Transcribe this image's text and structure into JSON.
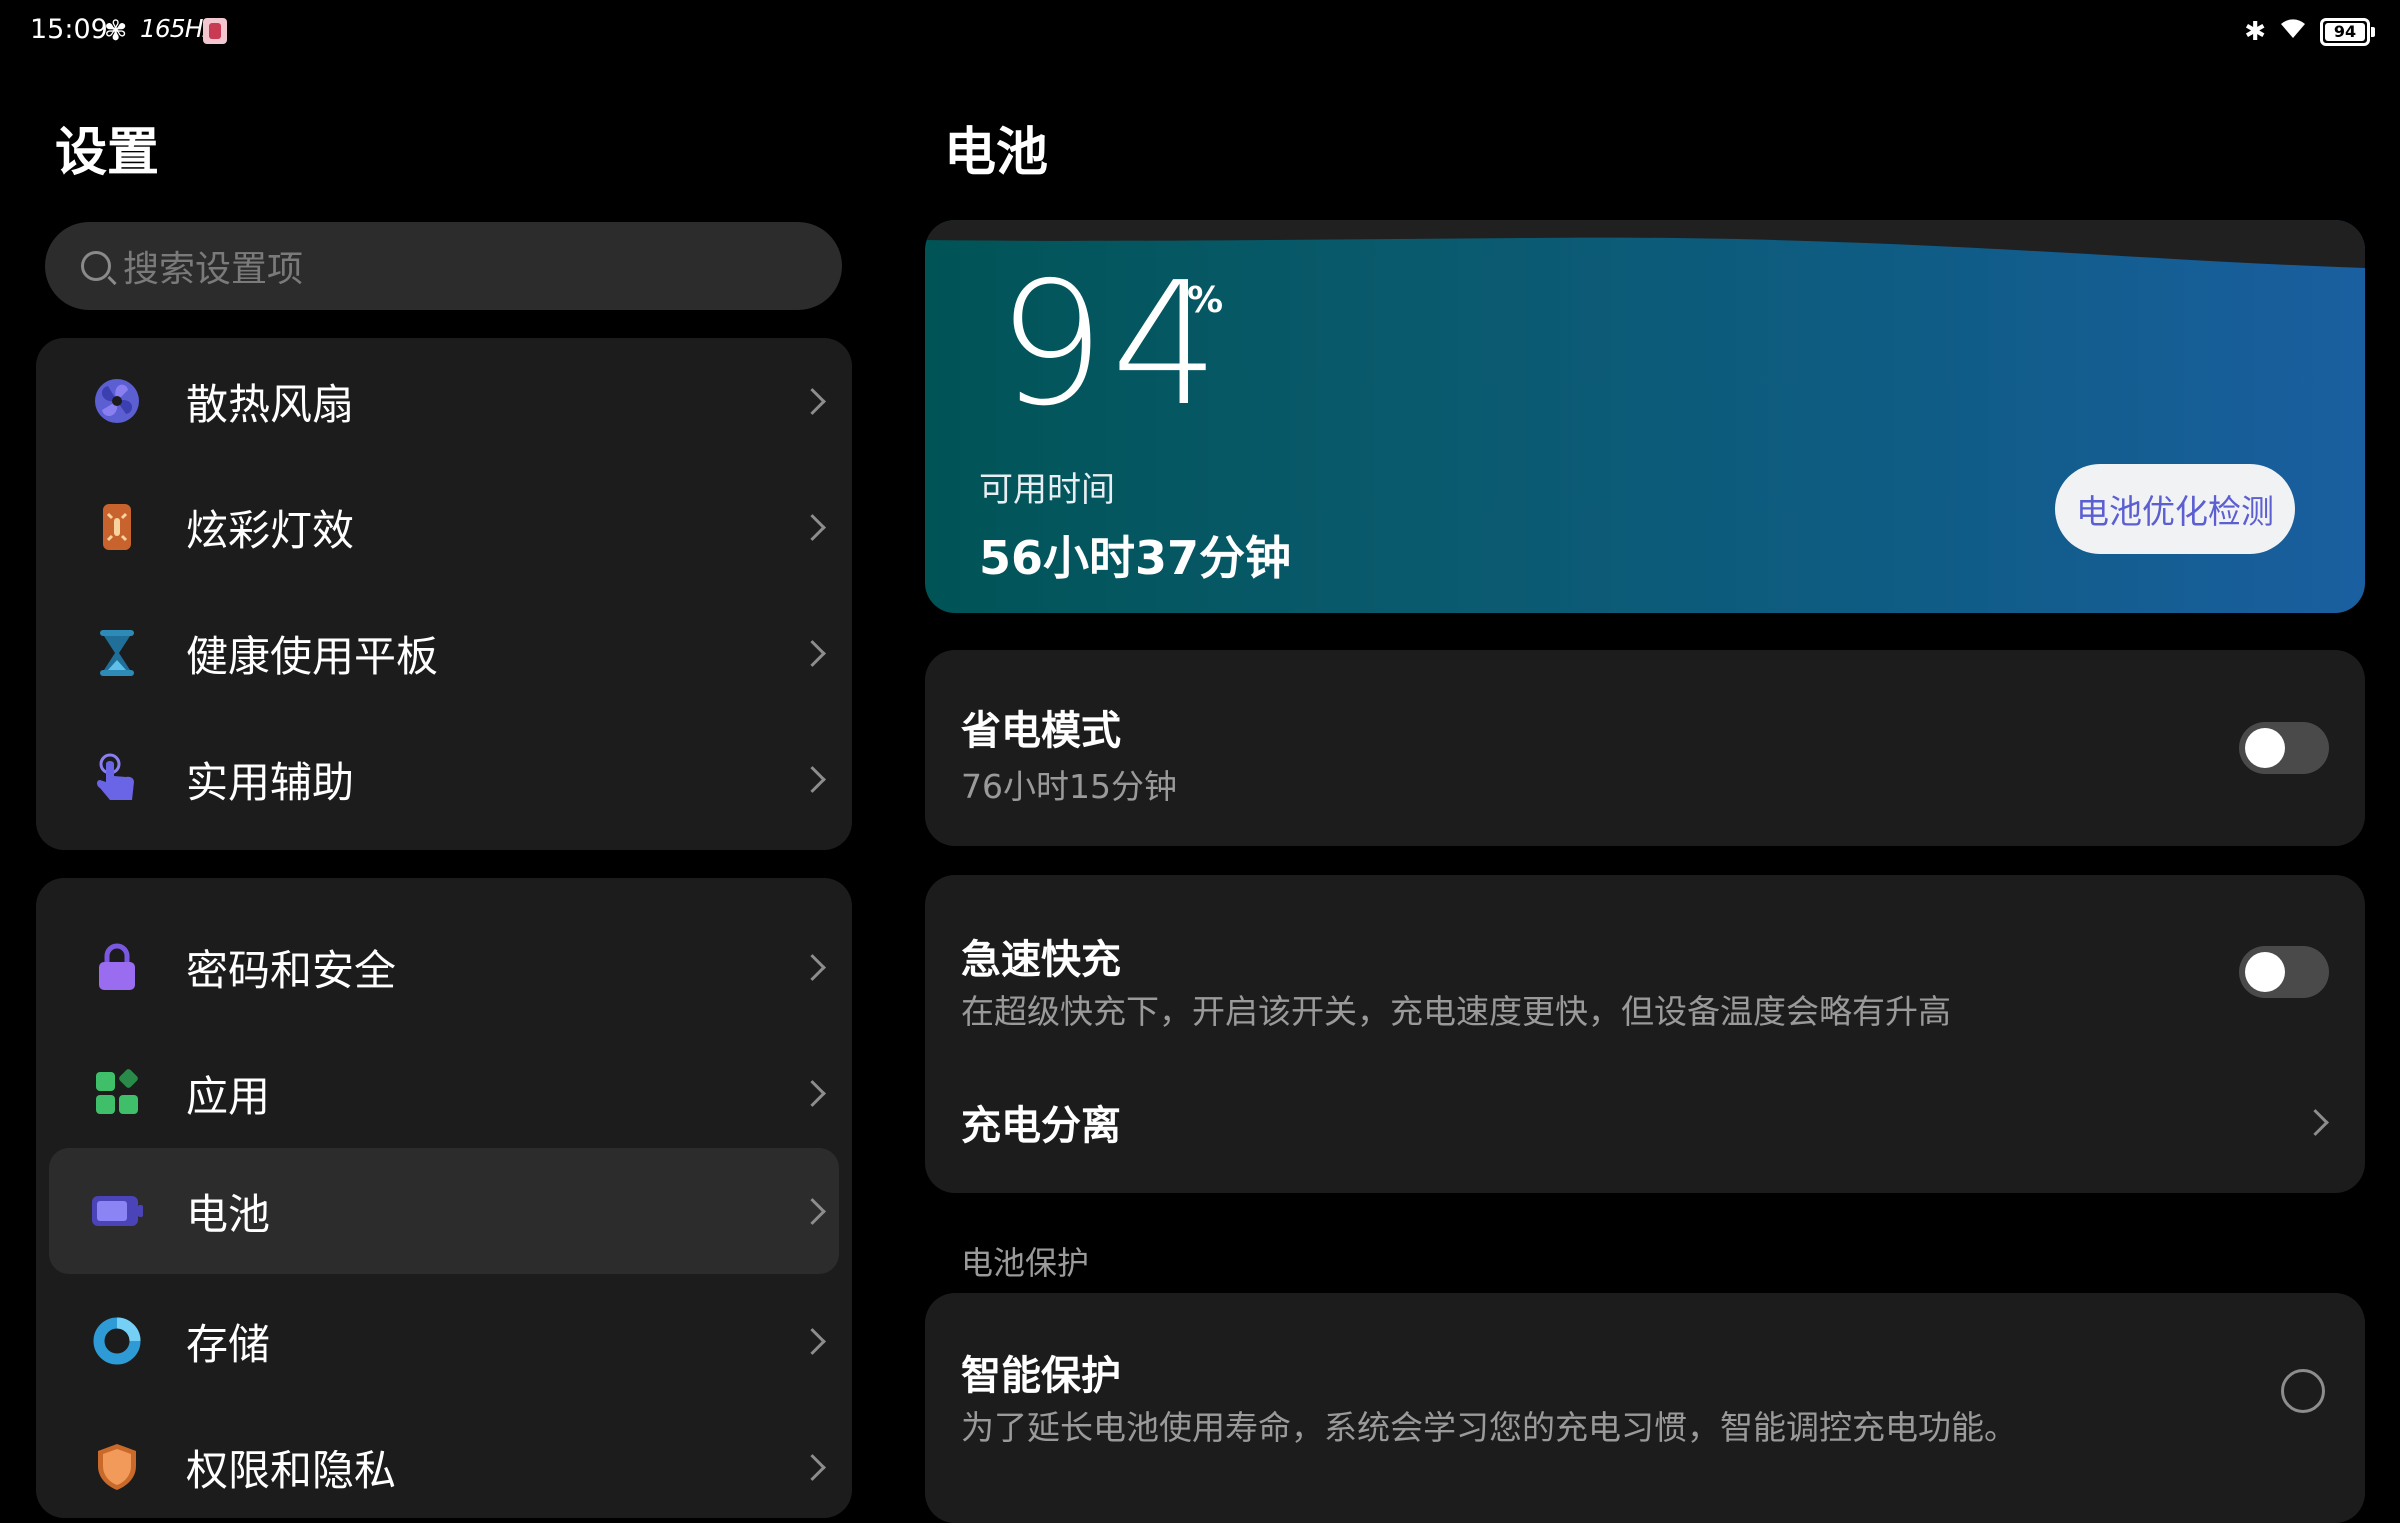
{
  "status_bar": {
    "time": "15:09",
    "refresh_rate": "165Hz",
    "battery_level": "94"
  },
  "left": {
    "title": "设置",
    "search_placeholder": "搜索设置项",
    "group1": [
      {
        "label": "散热风扇",
        "icon": "fan-icon"
      },
      {
        "label": "炫彩灯效",
        "icon": "light-effect-icon"
      },
      {
        "label": "健康使用平板",
        "icon": "hourglass-icon"
      },
      {
        "label": "实用辅助",
        "icon": "hand-pointer-icon"
      }
    ],
    "group2": [
      {
        "label": "密码和安全",
        "icon": "lock-icon"
      },
      {
        "label": "应用",
        "icon": "apps-grid-icon"
      },
      {
        "label": "电池",
        "icon": "battery-icon",
        "selected": true
      },
      {
        "label": "存储",
        "icon": "storage-pie-icon"
      },
      {
        "label": "权限和隐私",
        "icon": "shield-icon"
      }
    ]
  },
  "right": {
    "title": "电池",
    "hero": {
      "percent": "94",
      "percent_sign": "%",
      "available_label": "可用时间",
      "available_value": "56小时37分钟",
      "optimize_button": "电池优化检测"
    },
    "power_saving": {
      "title": "省电模式",
      "subtitle": "76小时15分钟",
      "enabled": false
    },
    "fast_charge": {
      "title": "急速快充",
      "subtitle": "在超级快充下，开启该开关，充电速度更快，但设备温度会略有升高",
      "enabled": false
    },
    "charge_separation": {
      "title": "充电分离"
    },
    "battery_protection": {
      "section_header": "电池保护",
      "title": "智能保护",
      "subtitle": "为了延长电池使用寿命，系统会学习您的充电习惯，智能调控充电功能。",
      "selected": false
    }
  },
  "colors": {
    "background": "#000000",
    "card": "#1c1c1c",
    "accent": "#5b5fd1"
  }
}
